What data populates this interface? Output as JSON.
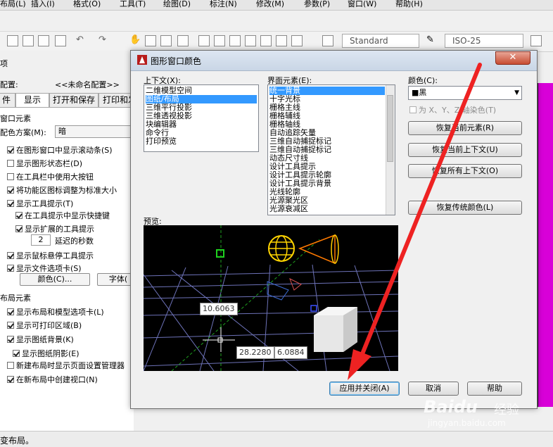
{
  "menu": [
    "布局(L)",
    "插入(I)",
    "格式(O)",
    "工具(T)",
    "绘图(D)",
    "标注(N)",
    "修改(M)",
    "参数(P)",
    "窗口(W)",
    "帮助(H)"
  ],
  "toolbar": {
    "text_style": "Standard",
    "dim_style": "ISO-25"
  },
  "options": {
    "title_fragment": "项",
    "config_label": "配置:",
    "config_value": "<<未命名配置>>",
    "tabs": [
      "件",
      "显示",
      "打开和保存",
      "打印和发"
    ],
    "section_window": "窗口元素",
    "scheme_label": "配色方案(M):",
    "scheme_value": "暗",
    "checks": [
      {
        "label": "在图形窗口中显示滚动条(S)",
        "checked": true
      },
      {
        "label": "显示图形状态栏(D)",
        "checked": false
      },
      {
        "label": "在工具栏中使用大按钮",
        "checked": false
      },
      {
        "label": "将功能区图标调整为标准大小",
        "checked": true
      },
      {
        "label": "显示工具提示(T)",
        "checked": true
      },
      {
        "label": "在工具提示中显示快捷键",
        "checked": true
      },
      {
        "label": "显示扩展的工具提示",
        "checked": true
      }
    ],
    "delay_value": "2",
    "delay_label": "延迟的秒数",
    "checks2": [
      {
        "label": "显示鼠标悬停工具提示",
        "checked": true
      },
      {
        "label": "显示文件选项卡(S)",
        "checked": true
      }
    ],
    "color_button": "颜色(C)...",
    "font_button": "字体(",
    "section_layout": "布局元素",
    "layout_checks": [
      {
        "label": "显示布局和模型选项卡(L)",
        "checked": true
      },
      {
        "label": "显示可打印区域(B)",
        "checked": true
      },
      {
        "label": "显示图纸背景(K)",
        "checked": true
      },
      {
        "label": "显示图纸阴影(E)",
        "checked": true
      },
      {
        "label": "新建布局时显示页面设置管理器",
        "checked": false
      },
      {
        "label": "在新布局中创建视口(N)",
        "checked": true
      }
    ]
  },
  "statusbar": {
    "text": "变布局。"
  },
  "dialog": {
    "title": "图形窗口颜色",
    "context_label": "上下文(X):",
    "contexts": [
      "二维模型空间",
      "图纸/布局",
      "三维平行投影",
      "三维透视投影",
      "块编辑器",
      "命令行",
      "打印预览"
    ],
    "context_selected": 1,
    "element_label": "界面元素(E):",
    "elements": [
      "统一背景",
      "十字光标",
      "栅格主线",
      "栅格辅线",
      "栅格轴线",
      "自动追踪矢量",
      "三维自动捕捉标记",
      "三维自动捕捉标记",
      "动态尺寸线",
      "设计工具提示",
      "设计工具提示轮廓",
      "设计工具提示背景",
      "光线轮廓",
      "光源聚光区",
      "光源衰减区"
    ],
    "element_selected": 0,
    "color_label": "颜色(C):",
    "color_value": "■黑",
    "tint_label": "为 X、Y、Z 轴染色(T)",
    "restore_element": "恢复当前元素(R)",
    "restore_context": "恢复当前上下文(U)",
    "restore_all": "恢复所有上下文(O)",
    "restore_classic": "恢复传统颜色(L)",
    "preview_label": "预览:",
    "coord_a": "10.6063",
    "coord_b": "28.2280",
    "coord_c": "6.0884",
    "apply_close": "应用并关闭(A)",
    "cancel": "取消",
    "help": "帮助"
  },
  "watermark": {
    "brand": "Baidu",
    "cn": "经验",
    "url": "jingyan.baidu.com"
  },
  "colors": {
    "arrow": "#ee2222",
    "drawing": "#d800d8",
    "selection": "#3399ff"
  }
}
